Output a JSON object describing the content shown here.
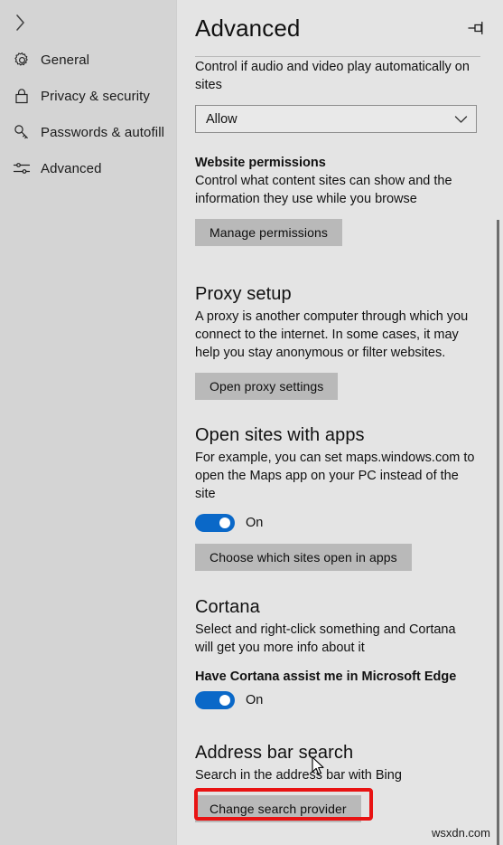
{
  "sidebar": {
    "back_icon": "chevron-right-icon",
    "items": [
      {
        "id": "general",
        "label": "General",
        "icon": "gear-icon"
      },
      {
        "id": "privacy",
        "label": "Privacy & security",
        "icon": "lock-icon"
      },
      {
        "id": "passwords",
        "label": "Passwords & autofill",
        "icon": "key-icon"
      },
      {
        "id": "advanced",
        "label": "Advanced",
        "icon": "sliders-icon"
      }
    ]
  },
  "header": {
    "title": "Advanced",
    "pin_icon": "pin-icon"
  },
  "sections": {
    "media_autoplay": {
      "description": "Control if audio and video play automatically on sites",
      "dropdown_value": "Allow",
      "dropdown_icon": "chevron-down-icon"
    },
    "website_permissions": {
      "heading": "Website permissions",
      "description": "Control what content sites can show and the information they use while you browse",
      "button": "Manage permissions"
    },
    "proxy_setup": {
      "heading": "Proxy setup",
      "description": "A proxy is another computer through which you connect to the internet. In some cases, it may help you stay anonymous or filter websites.",
      "button": "Open proxy settings"
    },
    "open_sites_with_apps": {
      "heading": "Open sites with apps",
      "description": "For example, you can set maps.windows.com to open the Maps app on your PC instead of the site",
      "toggle_state": "On",
      "button": "Choose which sites open in apps"
    },
    "cortana": {
      "heading": "Cortana",
      "description": "Select and right-click something and Cortana will get you more info about it",
      "subheading": "Have Cortana assist me in Microsoft Edge",
      "toggle_state": "On"
    },
    "address_bar_search": {
      "heading": "Address bar search",
      "description": "Search in the address bar with Bing",
      "button": "Change search provider"
    }
  },
  "watermark": "wsxdn.com",
  "colors": {
    "accent": "#0a68c8",
    "highlight": "#e81313",
    "sidebar_bg": "#d4d4d4",
    "content_bg": "#e4e4e4",
    "button_bg": "#b9b9b9"
  }
}
